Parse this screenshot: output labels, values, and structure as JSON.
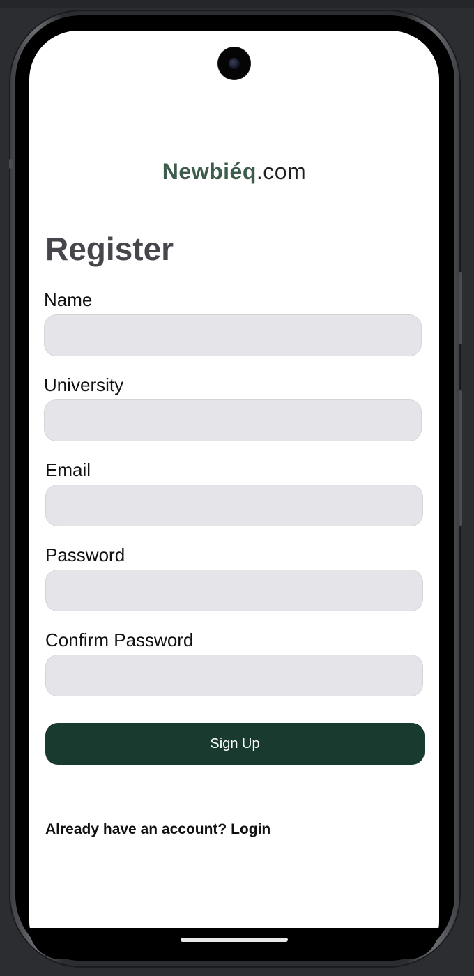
{
  "app": {
    "logo_brand": "Newbiéq",
    "logo_tld": ".com"
  },
  "form": {
    "title": "Register",
    "fields": [
      {
        "label": "Name",
        "value": "",
        "placeholder": ""
      },
      {
        "label": "University",
        "value": "",
        "placeholder": ""
      },
      {
        "label": "Email",
        "value": "",
        "placeholder": ""
      },
      {
        "label": "Password",
        "value": "",
        "placeholder": ""
      },
      {
        "label": "Confirm Password",
        "value": "",
        "placeholder": ""
      }
    ],
    "submit_label": "Sign Up",
    "login_prompt": "Already have an account? ",
    "login_link": "Login"
  },
  "colors": {
    "brand_green": "#3d5c4c",
    "button_bg": "#193a2e",
    "input_bg": "#e4e4e9",
    "title_color": "#47464d"
  }
}
